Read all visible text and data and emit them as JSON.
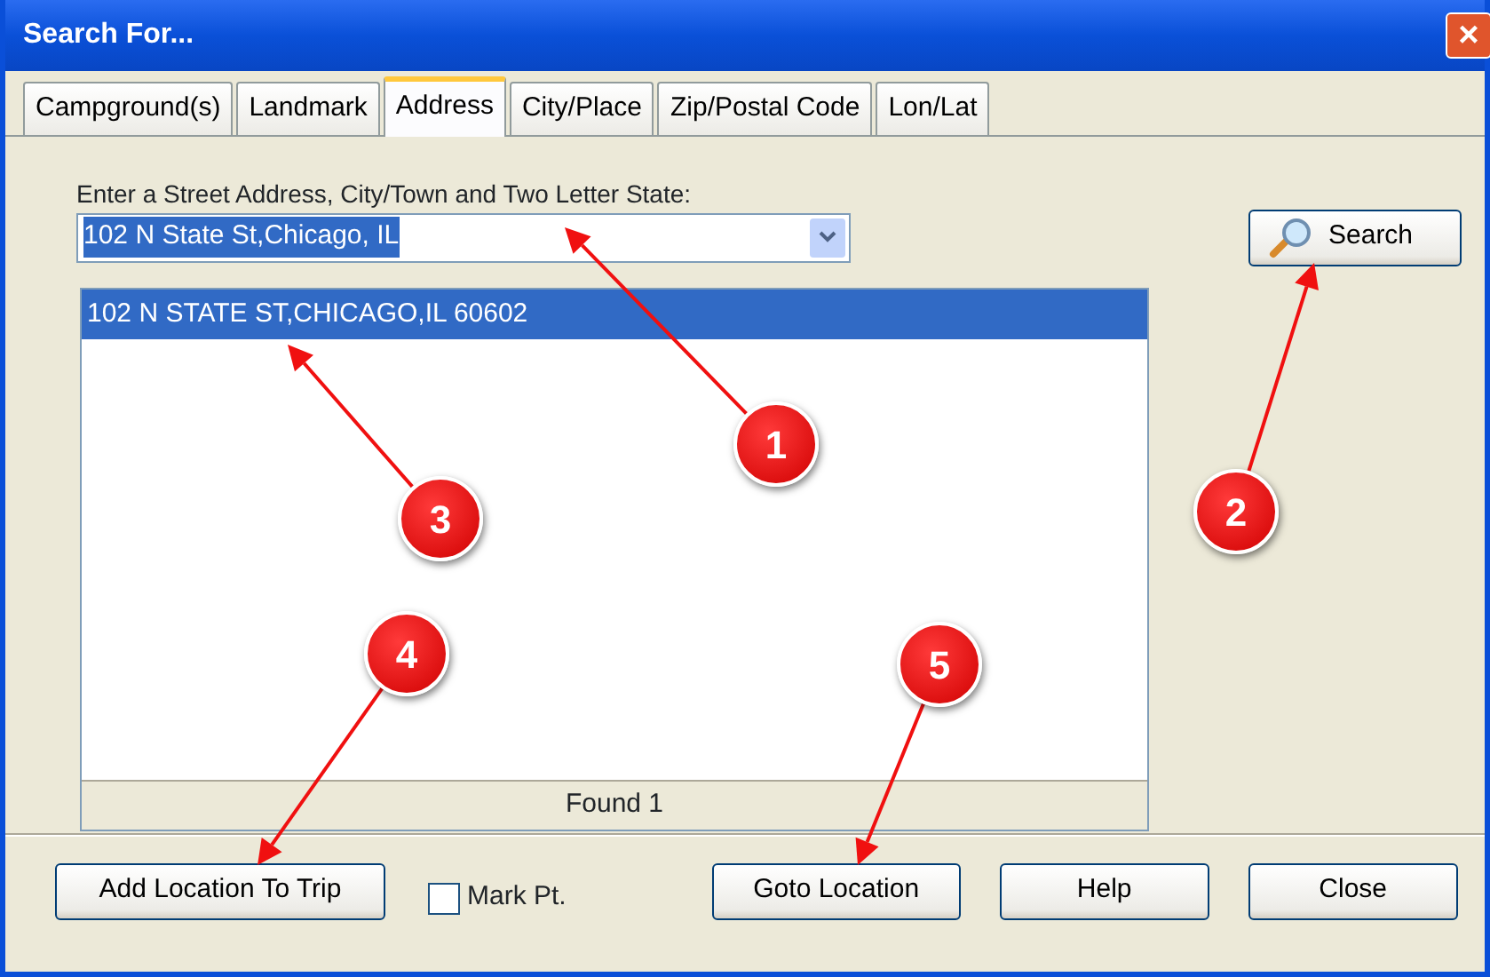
{
  "window": {
    "title": "Search For...",
    "close": "×"
  },
  "tabs": [
    {
      "label": "Campground(s)",
      "selected": false
    },
    {
      "label": "Landmark",
      "selected": false
    },
    {
      "label": "Address",
      "selected": true
    },
    {
      "label": "City/Place",
      "selected": false
    },
    {
      "label": "Zip/Postal Code",
      "selected": false
    },
    {
      "label": "Lon/Lat",
      "selected": false
    }
  ],
  "address_field": {
    "label": "Enter a Street Address, City/Town and  Two Letter State:",
    "value": "102 N State St,Chicago, IL"
  },
  "search_button": "Search",
  "results": [
    {
      "text": "102 N STATE ST,CHICAGO,IL 60602",
      "selected": true
    }
  ],
  "results_footer": "Found 1",
  "add_button": "Add Location To Trip",
  "mark_point": {
    "label": "Mark Pt.",
    "checked": false
  },
  "buttons": [
    "Goto Location",
    "Help",
    "Close"
  ],
  "callouts": [
    {
      "label": "1"
    },
    {
      "label": "2"
    },
    {
      "label": "3"
    },
    {
      "label": "4"
    },
    {
      "label": "5"
    }
  ]
}
